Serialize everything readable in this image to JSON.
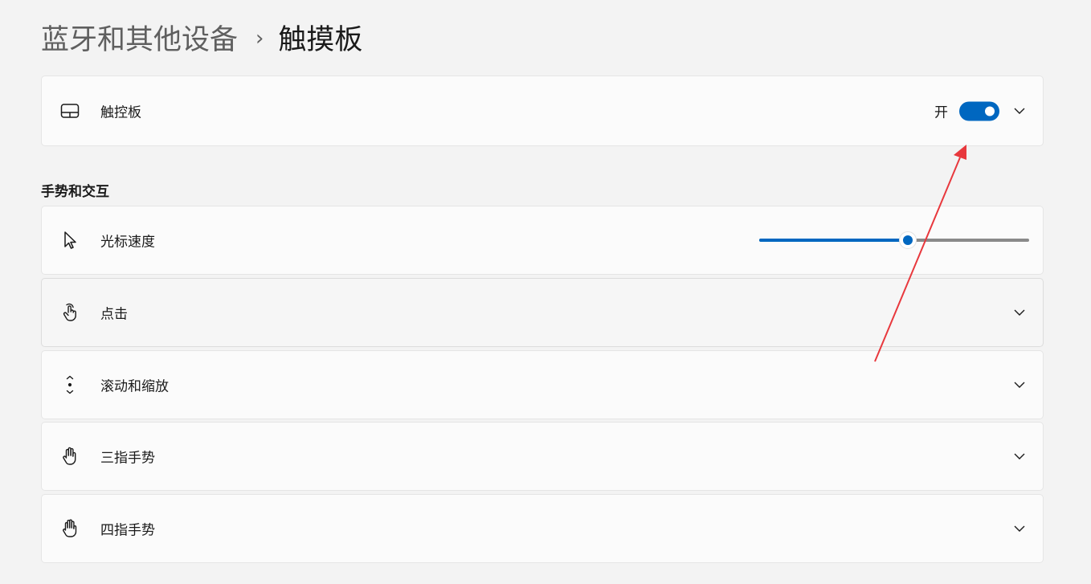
{
  "breadcrumb": {
    "parent": "蓝牙和其他设备",
    "separator": "›",
    "current": "触摸板"
  },
  "touchpad_card": {
    "icon": "touchpad-icon",
    "label": "触控板",
    "toggle_state_text": "开",
    "toggle_on": true
  },
  "section": {
    "title": "手势和交互"
  },
  "cursor_speed": {
    "icon": "cursor-icon",
    "label": "光标速度",
    "slider_value_percent": 55
  },
  "rows": [
    {
      "icon": "tap-hand-icon",
      "label": "点击"
    },
    {
      "icon": "scroll-zoom-icon",
      "label": "滚动和缩放"
    },
    {
      "icon": "three-finger-hand-icon",
      "label": "三指手势"
    },
    {
      "icon": "four-finger-hand-icon",
      "label": "四指手势"
    }
  ],
  "colors": {
    "accent": "#0067c0",
    "annotation_arrow": "#e8383d"
  }
}
